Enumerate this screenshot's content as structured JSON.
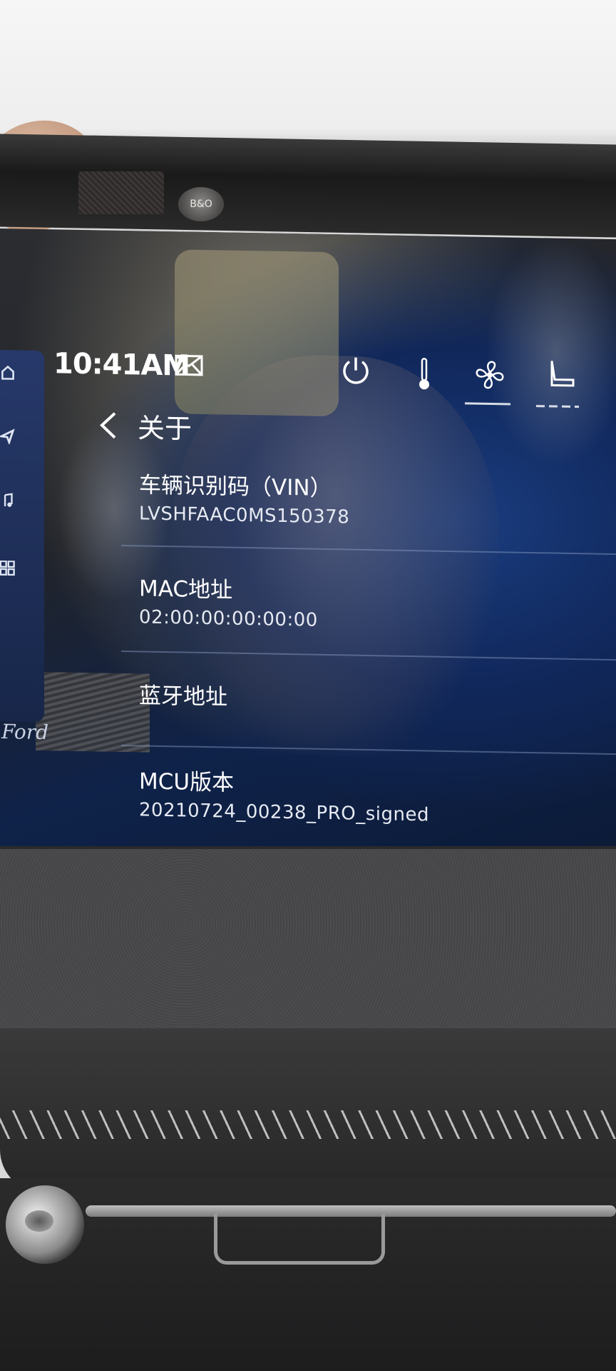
{
  "status_bar": {
    "time": "10:41AM"
  },
  "top_icons": [
    "mail-icon",
    "power-icon",
    "thermometer-icon",
    "fan-icon",
    "seat-icon"
  ],
  "sidebar": {
    "icons": [
      "home-icon",
      "navigation-icon",
      "music-icon",
      "apps-grid-icon"
    ],
    "brand": "Ford"
  },
  "page": {
    "title": "关于"
  },
  "items": [
    {
      "label": "车辆识别码（VIN）",
      "value": "LVSHFAAC0MS150378"
    },
    {
      "label": "MAC地址",
      "value": "02:00:00:00:00:00"
    },
    {
      "label": "蓝牙地址",
      "value": ""
    },
    {
      "label": "MCU版本",
      "value": "20210724_00238_PRO_signed"
    }
  ],
  "bezel": {
    "speaker_brand": "B&O"
  },
  "colors": {
    "screen_bg": "#10275a",
    "text": "#ffffff",
    "sidebar": "#27396a"
  }
}
